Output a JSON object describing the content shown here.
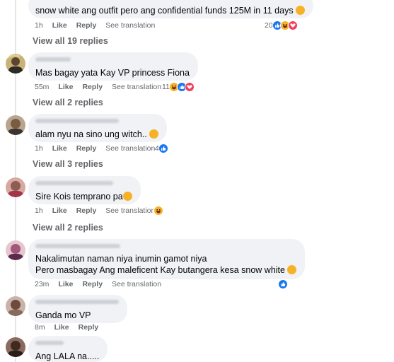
{
  "comments": [
    {
      "text": "snow white ang outfit pero ang confidential funds 125M in 11 days",
      "time": "1h",
      "like": "Like",
      "reply": "Reply",
      "see_translation": "See translation",
      "reaction_count": "20",
      "reactions": [
        "like-icon",
        "haha-icon",
        "love-icon"
      ],
      "view_replies": "View all 19 replies"
    },
    {
      "text": "Mas bagay yata Kay VP princess Fiona",
      "time": "55m",
      "like": "Like",
      "reply": "Reply",
      "see_translation": "See translation",
      "reaction_count": "11",
      "reactions": [
        "haha-icon",
        "like-icon",
        "love-icon"
      ],
      "view_replies": "View all 2 replies"
    },
    {
      "text": "alam nyu na sino ung witch..",
      "time": "1h",
      "like": "Like",
      "reply": "Reply",
      "see_translation": "See translation",
      "reaction_count": "4",
      "reactions": [
        "like-icon"
      ],
      "view_replies": "View all 3 replies"
    },
    {
      "text": "Sire Kois temprano pa",
      "time": "1h",
      "like": "Like",
      "reply": "Reply",
      "see_translation": "See translation",
      "reaction_count": "",
      "reactions": [
        "haha-icon"
      ],
      "view_replies": "View all 2 replies"
    },
    {
      "line1": "Nakalimutan naman niya inumin gamot niya",
      "line2": "Pero masbagay Ang maleficent Kay butangera kesa snow white",
      "time": "23m",
      "like": "Like",
      "reply": "Reply",
      "see_translation": "See translation",
      "reaction_count": "",
      "reactions": [
        "like-icon"
      ]
    },
    {
      "text": "Ganda mo VP",
      "time": "8m",
      "like": "Like",
      "reply": "Reply"
    },
    {
      "text": "Ang LALA na....."
    }
  ],
  "colors": {
    "bubble": "#f0f2f5",
    "meta": "#65676b",
    "like": "#1877f2",
    "haha": "#f7b125",
    "love": "#f33e58"
  }
}
